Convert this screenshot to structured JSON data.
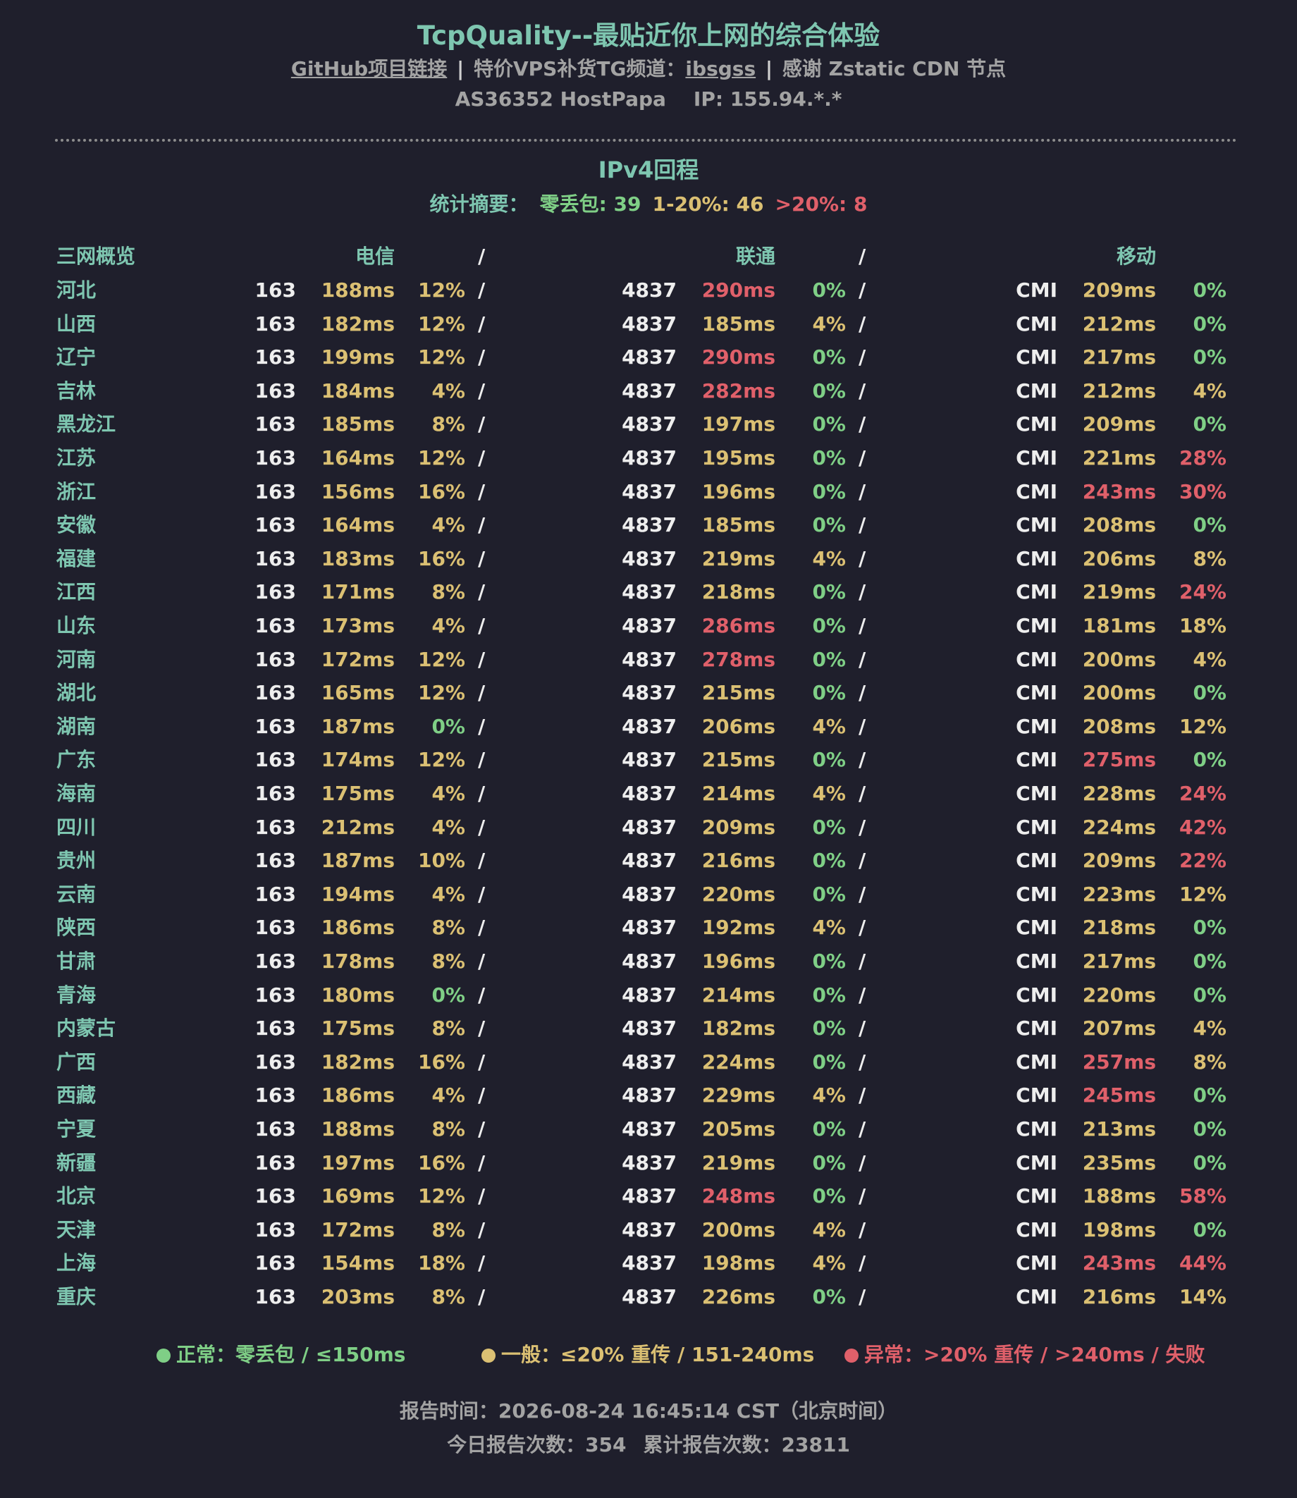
{
  "header": {
    "title": "TcpQuality--最贴近你上网的综合体验",
    "links": {
      "github": "GitHub项目链接",
      "sep": "|",
      "tg_prefix": "特价VPS补货TG频道：",
      "tg_channel": "ibsgss",
      "thanks": "感谢 Zstatic CDN 节点"
    },
    "asn": "AS36352 HostPapa",
    "ip": "IP: 155.94.*.*"
  },
  "section": {
    "title": "IPv4回程",
    "summary": {
      "label": "统计摘要：",
      "zero": "零丢包: 39",
      "mid": "1-20%: 46",
      "high": ">20%: 8"
    }
  },
  "table": {
    "headers": {
      "overview": "三网概览",
      "telecom": "电信",
      "unicom": "联通",
      "mobile": "移动",
      "slash": "/"
    },
    "rows": [
      {
        "prov": "河北",
        "ct": [
          "163",
          "188ms",
          "12%"
        ],
        "cu": [
          "4837",
          "290ms",
          "0%"
        ],
        "cm": [
          "CMI",
          "209ms",
          "0%"
        ]
      },
      {
        "prov": "山西",
        "ct": [
          "163",
          "182ms",
          "12%"
        ],
        "cu": [
          "4837",
          "185ms",
          "4%"
        ],
        "cm": [
          "CMI",
          "212ms",
          "0%"
        ]
      },
      {
        "prov": "辽宁",
        "ct": [
          "163",
          "199ms",
          "12%"
        ],
        "cu": [
          "4837",
          "290ms",
          "0%"
        ],
        "cm": [
          "CMI",
          "217ms",
          "0%"
        ]
      },
      {
        "prov": "吉林",
        "ct": [
          "163",
          "184ms",
          "4%"
        ],
        "cu": [
          "4837",
          "282ms",
          "0%"
        ],
        "cm": [
          "CMI",
          "212ms",
          "4%"
        ]
      },
      {
        "prov": "黑龙江",
        "ct": [
          "163",
          "185ms",
          "8%"
        ],
        "cu": [
          "4837",
          "197ms",
          "0%"
        ],
        "cm": [
          "CMI",
          "209ms",
          "0%"
        ]
      },
      {
        "prov": "江苏",
        "ct": [
          "163",
          "164ms",
          "12%"
        ],
        "cu": [
          "4837",
          "195ms",
          "0%"
        ],
        "cm": [
          "CMI",
          "221ms",
          "28%"
        ]
      },
      {
        "prov": "浙江",
        "ct": [
          "163",
          "156ms",
          "16%"
        ],
        "cu": [
          "4837",
          "196ms",
          "0%"
        ],
        "cm": [
          "CMI",
          "243ms",
          "30%"
        ]
      },
      {
        "prov": "安徽",
        "ct": [
          "163",
          "164ms",
          "4%"
        ],
        "cu": [
          "4837",
          "185ms",
          "0%"
        ],
        "cm": [
          "CMI",
          "208ms",
          "0%"
        ]
      },
      {
        "prov": "福建",
        "ct": [
          "163",
          "183ms",
          "16%"
        ],
        "cu": [
          "4837",
          "219ms",
          "4%"
        ],
        "cm": [
          "CMI",
          "206ms",
          "8%"
        ]
      },
      {
        "prov": "江西",
        "ct": [
          "163",
          "171ms",
          "8%"
        ],
        "cu": [
          "4837",
          "218ms",
          "0%"
        ],
        "cm": [
          "CMI",
          "219ms",
          "24%"
        ]
      },
      {
        "prov": "山东",
        "ct": [
          "163",
          "173ms",
          "4%"
        ],
        "cu": [
          "4837",
          "286ms",
          "0%"
        ],
        "cm": [
          "CMI",
          "181ms",
          "18%"
        ]
      },
      {
        "prov": "河南",
        "ct": [
          "163",
          "172ms",
          "12%"
        ],
        "cu": [
          "4837",
          "278ms",
          "0%"
        ],
        "cm": [
          "CMI",
          "200ms",
          "4%"
        ]
      },
      {
        "prov": "湖北",
        "ct": [
          "163",
          "165ms",
          "12%"
        ],
        "cu": [
          "4837",
          "215ms",
          "0%"
        ],
        "cm": [
          "CMI",
          "200ms",
          "0%"
        ]
      },
      {
        "prov": "湖南",
        "ct": [
          "163",
          "187ms",
          "0%"
        ],
        "cu": [
          "4837",
          "206ms",
          "4%"
        ],
        "cm": [
          "CMI",
          "208ms",
          "12%"
        ]
      },
      {
        "prov": "广东",
        "ct": [
          "163",
          "174ms",
          "12%"
        ],
        "cu": [
          "4837",
          "215ms",
          "0%"
        ],
        "cm": [
          "CMI",
          "275ms",
          "0%"
        ]
      },
      {
        "prov": "海南",
        "ct": [
          "163",
          "175ms",
          "4%"
        ],
        "cu": [
          "4837",
          "214ms",
          "4%"
        ],
        "cm": [
          "CMI",
          "228ms",
          "24%"
        ]
      },
      {
        "prov": "四川",
        "ct": [
          "163",
          "212ms",
          "4%"
        ],
        "cu": [
          "4837",
          "209ms",
          "0%"
        ],
        "cm": [
          "CMI",
          "224ms",
          "42%"
        ]
      },
      {
        "prov": "贵州",
        "ct": [
          "163",
          "187ms",
          "10%"
        ],
        "cu": [
          "4837",
          "216ms",
          "0%"
        ],
        "cm": [
          "CMI",
          "209ms",
          "22%"
        ]
      },
      {
        "prov": "云南",
        "ct": [
          "163",
          "194ms",
          "4%"
        ],
        "cu": [
          "4837",
          "220ms",
          "0%"
        ],
        "cm": [
          "CMI",
          "223ms",
          "12%"
        ]
      },
      {
        "prov": "陕西",
        "ct": [
          "163",
          "186ms",
          "8%"
        ],
        "cu": [
          "4837",
          "192ms",
          "4%"
        ],
        "cm": [
          "CMI",
          "218ms",
          "0%"
        ]
      },
      {
        "prov": "甘肃",
        "ct": [
          "163",
          "178ms",
          "8%"
        ],
        "cu": [
          "4837",
          "196ms",
          "0%"
        ],
        "cm": [
          "CMI",
          "217ms",
          "0%"
        ]
      },
      {
        "prov": "青海",
        "ct": [
          "163",
          "180ms",
          "0%"
        ],
        "cu": [
          "4837",
          "214ms",
          "0%"
        ],
        "cm": [
          "CMI",
          "220ms",
          "0%"
        ]
      },
      {
        "prov": "内蒙古",
        "ct": [
          "163",
          "175ms",
          "8%"
        ],
        "cu": [
          "4837",
          "182ms",
          "0%"
        ],
        "cm": [
          "CMI",
          "207ms",
          "4%"
        ]
      },
      {
        "prov": "广西",
        "ct": [
          "163",
          "182ms",
          "16%"
        ],
        "cu": [
          "4837",
          "224ms",
          "0%"
        ],
        "cm": [
          "CMI",
          "257ms",
          "8%"
        ]
      },
      {
        "prov": "西藏",
        "ct": [
          "163",
          "186ms",
          "4%"
        ],
        "cu": [
          "4837",
          "229ms",
          "4%"
        ],
        "cm": [
          "CMI",
          "245ms",
          "0%"
        ]
      },
      {
        "prov": "宁夏",
        "ct": [
          "163",
          "188ms",
          "8%"
        ],
        "cu": [
          "4837",
          "205ms",
          "0%"
        ],
        "cm": [
          "CMI",
          "213ms",
          "0%"
        ]
      },
      {
        "prov": "新疆",
        "ct": [
          "163",
          "197ms",
          "16%"
        ],
        "cu": [
          "4837",
          "219ms",
          "0%"
        ],
        "cm": [
          "CMI",
          "235ms",
          "0%"
        ]
      },
      {
        "prov": "北京",
        "ct": [
          "163",
          "169ms",
          "12%"
        ],
        "cu": [
          "4837",
          "248ms",
          "0%"
        ],
        "cm": [
          "CMI",
          "188ms",
          "58%"
        ]
      },
      {
        "prov": "天津",
        "ct": [
          "163",
          "172ms",
          "8%"
        ],
        "cu": [
          "4837",
          "200ms",
          "4%"
        ],
        "cm": [
          "CMI",
          "198ms",
          "0%"
        ]
      },
      {
        "prov": "上海",
        "ct": [
          "163",
          "154ms",
          "18%"
        ],
        "cu": [
          "4837",
          "198ms",
          "4%"
        ],
        "cm": [
          "CMI",
          "243ms",
          "44%"
        ]
      },
      {
        "prov": "重庆",
        "ct": [
          "163",
          "203ms",
          "8%"
        ],
        "cu": [
          "4837",
          "226ms",
          "0%"
        ],
        "cm": [
          "CMI",
          "216ms",
          "14%"
        ]
      }
    ]
  },
  "legend": {
    "normal": "正常：零丢包 / ≤150ms",
    "fair": "一般：≤20% 重传 / 151-240ms",
    "abnormal": "异常：>20% 重传 / >240ms / 失败"
  },
  "footer": {
    "report_time": "报告时间：2026-08-24 16:45:14 CST（北京时间）",
    "today_count": "今日报告次数：354",
    "total_count": "累计报告次数：23811"
  },
  "colors": {
    "background": "#1f1f2c",
    "teal": "#7ec6b0",
    "green": "#7fcf86",
    "yellow": "#dbc073",
    "red": "#e0606a",
    "gray": "#a3a3a3"
  }
}
